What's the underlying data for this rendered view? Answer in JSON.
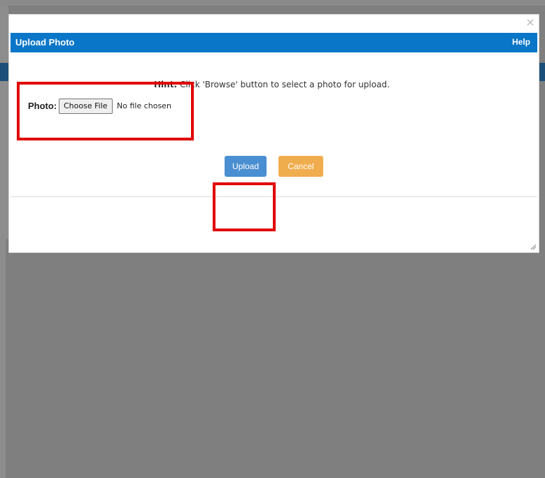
{
  "dialog": {
    "title": "Upload Photo",
    "help_label": "Help",
    "close_glyph": "×"
  },
  "hint": {
    "label": "Hint:",
    "text": " Click 'Browse' button to select a photo for upload."
  },
  "photo_field": {
    "label": "Photo:",
    "choose_label": "Choose File",
    "status": "No file chosen"
  },
  "buttons": {
    "upload": "Upload",
    "cancel": "Cancel"
  },
  "colors": {
    "header": "#0a76c8",
    "upload_button": "#4a8fd1",
    "cancel_button": "#f0ad4e",
    "annotation": "#e00000"
  },
  "icons": {
    "close": "close-icon",
    "resize": "resize-grip-icon"
  }
}
